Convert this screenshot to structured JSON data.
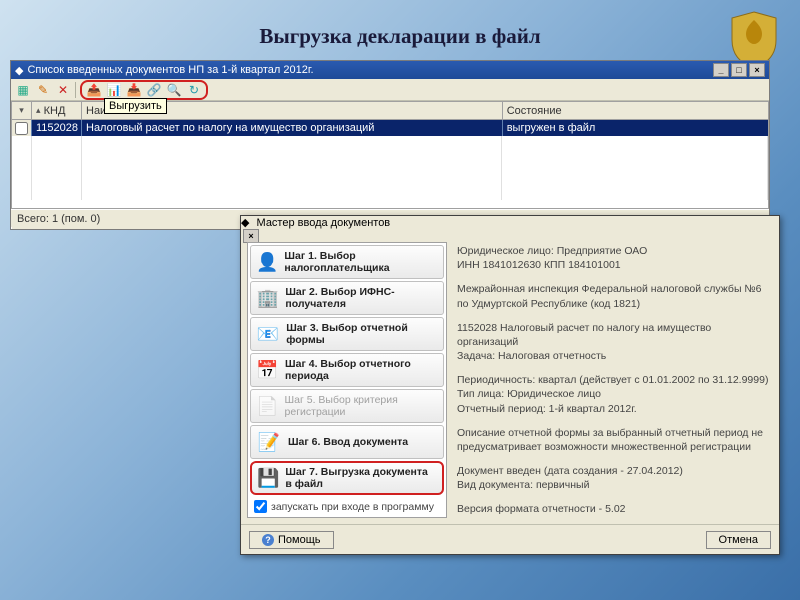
{
  "slide": {
    "title": "Выгрузка декларации в файл"
  },
  "listwin": {
    "title": "Список введенных документов НП за 1-й квартал 2012г.",
    "tooltip": "Выгрузить",
    "columns": {
      "c0": "",
      "c1": "КНД",
      "c2": "Наименование",
      "c3": "Состояние"
    },
    "row": {
      "knd": "1152028",
      "name": "Налоговый расчет по налогу на имущество организаций",
      "state": "выгружен в файл"
    },
    "status": "Всего: 1 (пом. 0)"
  },
  "wizard": {
    "title": "Мастер ввода документов",
    "steps": {
      "s1": "Шаг 1. Выбор налогоплательщика",
      "s2": "Шаг 2. Выбор ИФНС-получателя",
      "s3": "Шаг 3. Выбор отчетной формы",
      "s4": "Шаг 4. Выбор отчетного периода",
      "s5": "Шаг 5. Выбор критерия регистрации",
      "s6": "Шаг 6. Ввод документа",
      "s7": "Шаг 7. Выгрузка документа в файл"
    },
    "auto": "запускать при входе в программу",
    "info": {
      "b1": "Юридическое лицо: Предприятие ОАО\nИНН 1841012630   КПП 184101001",
      "b2": "Межрайонная инспекция Федеральной налоговой службы №6 по Удмуртской Республике (код 1821)",
      "b3": "1152028 Налоговый расчет по налогу на имущество организаций\nЗадача: Налоговая отчетность",
      "b4": "Периодичность: квартал (действует с 01.01.2002 по 31.12.9999)\nТип лица: Юридическое лицо\nОтчетный период: 1-й квартал 2012г.",
      "b5": "Описание отчетной формы за выбранный отчетный период не предусматривает возможности множественной регистрации",
      "b6": "Документ введен (дата создания - 27.04.2012)\nВид документа: первичный",
      "b7": "Версия формата отчетности - 5.02"
    },
    "buttons": {
      "help": "Помощь",
      "cancel": "Отмена"
    }
  }
}
